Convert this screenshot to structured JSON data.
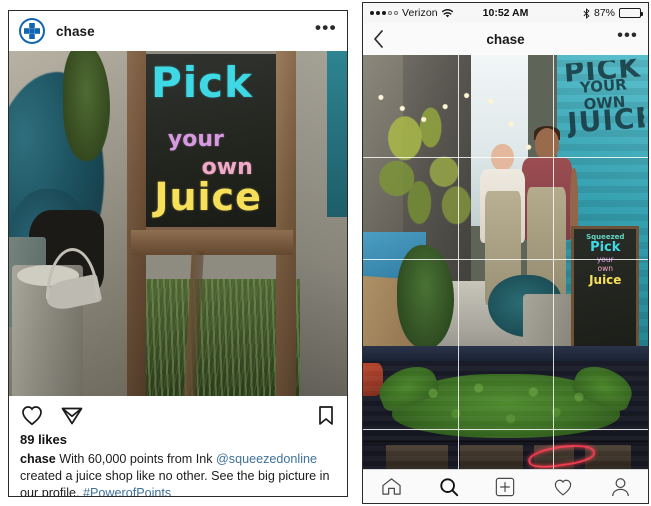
{
  "left_post": {
    "header": {
      "avatar_icon": "chase-logo-icon",
      "username": "chase",
      "more_label": "•••",
      "more_icon": "more-options-icon"
    },
    "photo": {
      "alt_name": "chalkboard-sign-photo",
      "chalk_line1": "Pick",
      "chalk_line2": "your",
      "chalk_line3": "own",
      "chalk_line4": "Juice"
    },
    "actions": {
      "like_icon": "heart-icon",
      "share_icon": "paper-plane-icon",
      "save_icon": "bookmark-icon"
    },
    "likes": "89 likes",
    "caption": {
      "username": "chase",
      "text_1": " With 60,000 points from Ink ",
      "mention": "@squeezedonline",
      "text_2": " created a juice shop like no other. See the big picture in our profile. ",
      "hashtag": "#PowerofPoints"
    }
  },
  "right_phone": {
    "statusbar": {
      "carrier": "Verizon",
      "wifi_icon": "wifi-icon",
      "time": "10:52 AM",
      "bluetooth_icon": "bluetooth-icon",
      "battery_percent": "87%",
      "battery_icon": "battery-icon"
    },
    "navbar": {
      "back_icon": "chevron-left-icon",
      "title": "chase",
      "more_label": "•••",
      "more_icon": "more-options-icon"
    },
    "photo": {
      "alt_name": "alley-juice-shop-photo",
      "wall_paint_big": "PICK",
      "wall_paint_small": "YOUR OWN",
      "wall_paint_big2": "JUICE",
      "board_line1": "Squeezed",
      "board_line2": "Pick",
      "board_line3": "your",
      "board_line4": "own",
      "board_line5": "Juice",
      "grid_overlay": true
    },
    "photo2": {
      "alt_name": "mustache-topiary-photo"
    },
    "tabbar": {
      "items": [
        {
          "name": "home-icon",
          "label": "Home",
          "active": false
        },
        {
          "name": "search-icon",
          "label": "Search",
          "active": true
        },
        {
          "name": "add-post-icon",
          "label": "New Post",
          "active": false
        },
        {
          "name": "activity-heart-icon",
          "label": "Activity",
          "active": false
        },
        {
          "name": "profile-icon",
          "label": "Profile",
          "active": false
        }
      ]
    }
  },
  "colors": {
    "chase_blue": "#1165b0",
    "link_blue": "#3f729b",
    "text_dark": "#131313",
    "chalk_cyan": "#3fd9e6",
    "chalk_pink": "#d79ae0",
    "chalk_yellow": "#f6e05a"
  }
}
